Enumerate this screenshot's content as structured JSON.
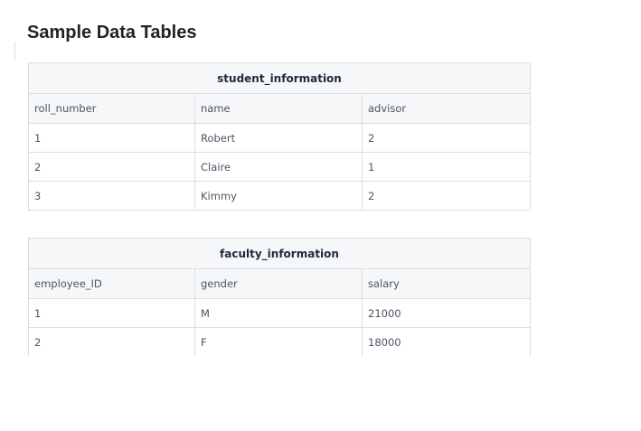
{
  "page": {
    "title": "Sample Data Tables"
  },
  "tables": [
    {
      "caption": "student_information",
      "columns": [
        "roll_number",
        "name",
        "advisor"
      ],
      "rows": [
        [
          "1",
          "Robert",
          "2"
        ],
        [
          "2",
          "Claire",
          "1"
        ],
        [
          "3",
          "Kimmy",
          "2"
        ]
      ]
    },
    {
      "caption": "faculty_information",
      "columns": [
        "employee_ID",
        "gender",
        "salary"
      ],
      "rows": [
        [
          "1",
          "M",
          "21000"
        ],
        [
          "2",
          "F",
          "18000"
        ]
      ]
    }
  ]
}
